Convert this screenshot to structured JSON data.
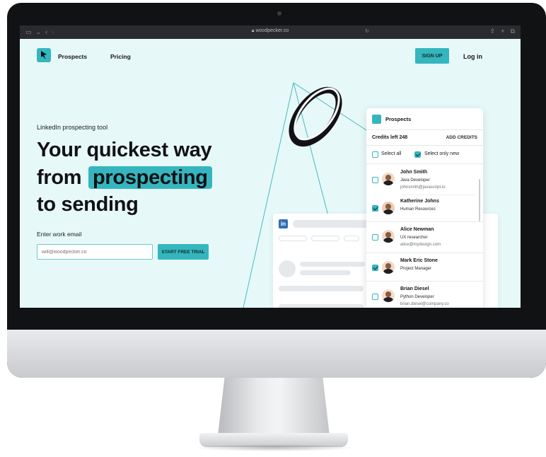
{
  "browser": {
    "url": "woodpecker.co",
    "tab_icons": [
      "sidebar-icon",
      "chevron-down-icon",
      "back-icon",
      "forward-icon"
    ],
    "right_icons": [
      "share-icon",
      "plus-icon",
      "tabs-icon"
    ]
  },
  "nav": {
    "brand": "Prospects",
    "pricing": "Pricing",
    "signup": "SIGN UP",
    "login": "Log in"
  },
  "hero": {
    "kicker": "LinkedIn prospecting tool",
    "line1": "Your quickest way",
    "line2_prefix": "from",
    "line2_highlight": "prospecting",
    "line3": "to sending",
    "email_label": "Enter work email",
    "email_placeholder": "will@woodpecker.co",
    "cta": "START FREE TRIAL"
  },
  "linkedin": {
    "logo": "in"
  },
  "panel": {
    "title": "Prospects",
    "credits": "Credits left  248",
    "add_credits": "ADD CREDITS",
    "select_all": "Select all",
    "select_only_new": "Select only new",
    "prospects": [
      {
        "name": "John Smith",
        "job": "Java Developer",
        "email": "johnsmith@javascript.io",
        "checked": false
      },
      {
        "name": "Katherine Johns",
        "job": "Human Resources",
        "email": "",
        "checked": true
      },
      {
        "name": "Alice Newman",
        "job": "UX researcher",
        "email": "alice@mydesign.com",
        "checked": false
      },
      {
        "name": "Mark Eric Stone",
        "job": "Project Manager",
        "email": "",
        "checked": true
      },
      {
        "name": "Brian Diesel",
        "job": "Python Developer",
        "email": "brian.diesel@company.co",
        "checked": false
      }
    ]
  },
  "colors": {
    "accent": "#35b6be",
    "page_bg": "#e7f8f8",
    "text": "#15151a"
  }
}
